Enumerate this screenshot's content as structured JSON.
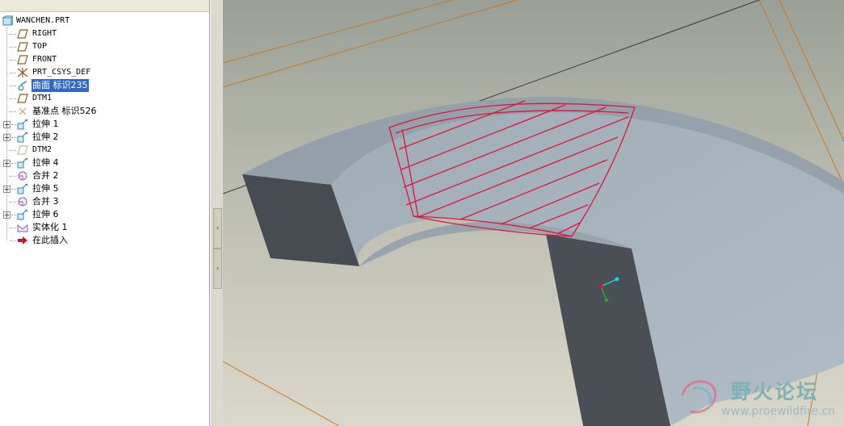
{
  "model_tree": {
    "root": {
      "label": "WANCHEN.PRT"
    },
    "items": [
      {
        "label": "RIGHT",
        "icon": "datum-plane-icon"
      },
      {
        "label": "TOP",
        "icon": "datum-plane-icon"
      },
      {
        "label": "FRONT",
        "icon": "datum-plane-icon"
      },
      {
        "label": "PRT_CSYS_DEF",
        "icon": "csys-icon"
      },
      {
        "label": "曲面 标识235",
        "icon": "surface-icon",
        "selected": true
      },
      {
        "label": "DTM1",
        "icon": "datum-plane-icon"
      },
      {
        "label": "基准点 标识526",
        "icon": "datum-point-icon"
      },
      {
        "label": "拉伸 1",
        "icon": "extrude-icon",
        "expandable": true
      },
      {
        "label": "拉伸 2",
        "icon": "extrude-icon",
        "expandable": true
      },
      {
        "label": "DTM2",
        "icon": "datum-plane-hidden-icon"
      },
      {
        "label": "拉伸 4",
        "icon": "extrude-icon",
        "expandable": true
      },
      {
        "label": "合并 2",
        "icon": "merge-icon"
      },
      {
        "label": "拉伸 5",
        "icon": "extrude-icon",
        "expandable": true
      },
      {
        "label": "合并 3",
        "icon": "merge-icon"
      },
      {
        "label": "拉伸 6",
        "icon": "extrude-icon",
        "expandable": true
      },
      {
        "label": "实体化 1",
        "icon": "solidify-icon"
      },
      {
        "label": "在此插入",
        "icon": "insert-here-arrow-icon"
      }
    ]
  },
  "splitter": {
    "collapse_glyph": "‹",
    "expand_glyph": "›"
  },
  "watermark": {
    "title": "野火论坛",
    "url": "www.proewildfire.cn"
  },
  "colors": {
    "selection": "#316ac5",
    "sketch_hatch": "#e0143c",
    "model_face": "#a8b4be",
    "model_dark_face": "#4a4e54",
    "background_top": "#a0a49a",
    "background_bottom": "#d8d6c8",
    "datum_edge": "#c8782a"
  }
}
